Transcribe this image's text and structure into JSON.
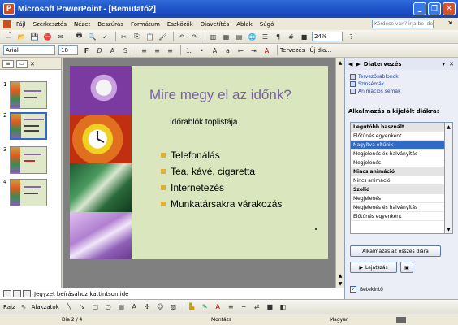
{
  "window": {
    "title": "Microsoft PowerPoint - [Bemutató2]",
    "app_icon": "P"
  },
  "menu": {
    "items": [
      "Fájl",
      "Szerkesztés",
      "Nézet",
      "Beszúrás",
      "Formátum",
      "Eszközök",
      "Diavetítés",
      "Ablak",
      "Súgó"
    ],
    "help_placeholder": "Kérdése van? Írja be ide."
  },
  "toolbar_standard": {
    "zoom": "24%"
  },
  "toolbar_format": {
    "font": "Arial",
    "size": "18",
    "design_label": "Tervezés",
    "new_slide_label": "Új dia..."
  },
  "slide": {
    "title": "Mire megy el az időnk?",
    "subtitle": "Időrablók toplistája",
    "bullets": [
      "Telefonálás",
      "Tea, kávé, cigaretta",
      "Internetezés",
      "Munkatársakra várakozás"
    ]
  },
  "notes_placeholder": "Jegyzet beírásához kattintson ide",
  "task_pane": {
    "title": "Diatervezés",
    "links": [
      "Tervezősablonok",
      "Színsémák",
      "Animációs sémák"
    ],
    "apply_heading": "Alkalmazás a kijelölt diákra:",
    "animations": [
      {
        "label": "Legutóbb használt",
        "kind": "hdr"
      },
      {
        "label": "Előtűnés egyenként",
        "kind": ""
      },
      {
        "label": "Nagyítva eltűnik",
        "kind": "sel"
      },
      {
        "label": "Megjelenés és halványítás",
        "kind": ""
      },
      {
        "label": "Megjelenés",
        "kind": ""
      },
      {
        "label": "Nincs animáció",
        "kind": "hdr"
      },
      {
        "label": "Nincs animáció",
        "kind": ""
      },
      {
        "label": "Szolid",
        "kind": "hdr"
      },
      {
        "label": "Megjelenés",
        "kind": ""
      },
      {
        "label": "Megjelenés és halványítás",
        "kind": ""
      },
      {
        "label": "Előtűnés egyenként",
        "kind": ""
      }
    ],
    "apply_all_button": "Alkalmazás az összes diára",
    "play_button": "Lejátszás",
    "autopreview_label": "Betekintő"
  },
  "drawing_toolbar": {
    "draw_label": "Rajz",
    "autoshapes_label": "Alakzatok"
  },
  "status": {
    "slide_pos": "Dia 2 / 4",
    "design": "Montázs",
    "language": "Magyar"
  },
  "slides_panel": {
    "numbers": [
      "1",
      "2",
      "3",
      "4"
    ]
  }
}
